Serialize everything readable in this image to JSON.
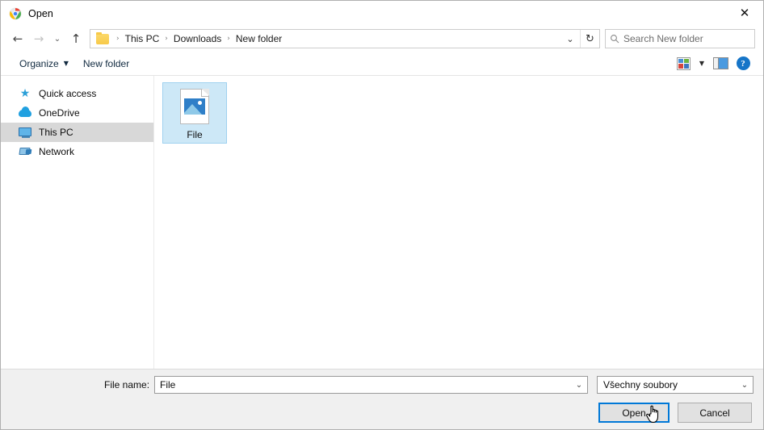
{
  "window": {
    "title": "Open",
    "app_icon": "chrome-logo-icon",
    "close_label": "✕"
  },
  "nav": {
    "back_icon": "←",
    "forward_icon": "→",
    "history_icon": "⌄",
    "up_icon": "↑"
  },
  "address": {
    "folder_icon": "folder-icon",
    "crumbs": [
      "This PC",
      "Downloads",
      "New folder"
    ],
    "separator": "›",
    "dropdown_icon": "⌄",
    "refresh_icon": "↻"
  },
  "search": {
    "icon": "search-icon",
    "placeholder": "Search New folder",
    "value": ""
  },
  "toolbar": {
    "organize_label": "Organize",
    "organize_caret": "▼",
    "new_folder_label": "New folder",
    "view_icon": "view-options-icon",
    "view_caret": "▼",
    "preview_pane_icon": "preview-pane-icon",
    "help_label": "?"
  },
  "sidebar": {
    "items": [
      {
        "label": "Quick access",
        "icon": "star-icon",
        "selected": false
      },
      {
        "label": "OneDrive",
        "icon": "cloud-icon",
        "selected": false
      },
      {
        "label": "This PC",
        "icon": "monitor-icon",
        "selected": true
      },
      {
        "label": "Network",
        "icon": "network-icon",
        "selected": false
      }
    ]
  },
  "content": {
    "files": [
      {
        "name": "File",
        "icon": "image-file-icon",
        "selected": true
      }
    ]
  },
  "footer": {
    "file_name_label": "File name:",
    "file_name_value": "File",
    "file_name_dropdown_icon": "⌄",
    "filter_value": "Všechny soubory",
    "filter_dropdown_icon": "⌄",
    "open_label": "Open",
    "cancel_label": "Cancel"
  },
  "cursor": {
    "type": "hand-pointer"
  },
  "colors": {
    "accent": "#0078d7",
    "selection": "#cde8f7",
    "sidebar_selected": "#d8d8d8",
    "footer_bg": "#f0f0f0"
  }
}
